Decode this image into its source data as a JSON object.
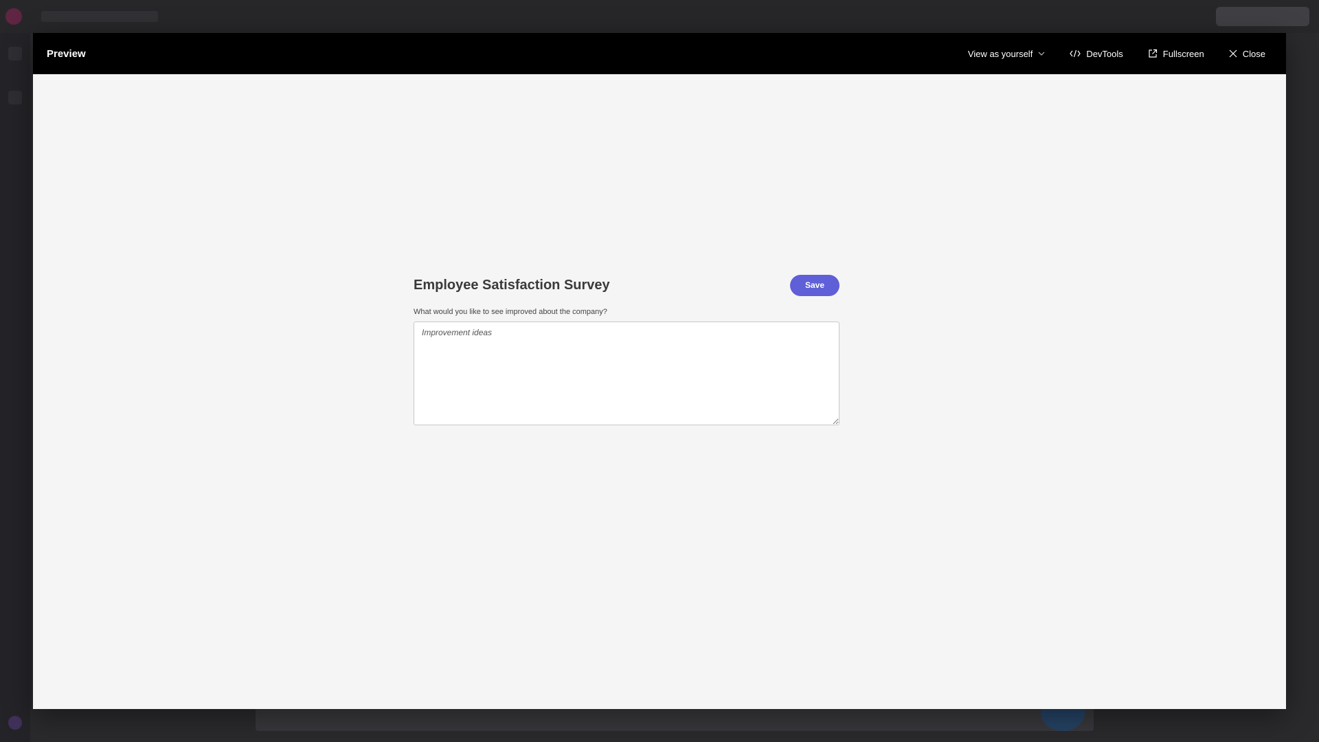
{
  "modal": {
    "title": "Preview",
    "actions": {
      "view_as": "View as yourself",
      "devtools": "DevTools",
      "fullscreen": "Fullscreen",
      "close": "Close"
    }
  },
  "form": {
    "title": "Employee Satisfaction Survey",
    "save_label": "Save",
    "question_label": "What would you like to see improved about the company?",
    "textarea_placeholder": "Improvement ideas",
    "textarea_value": ""
  },
  "colors": {
    "header_bg": "#000000",
    "body_bg": "#f5f5f5",
    "accent": "#5f5fd8"
  }
}
